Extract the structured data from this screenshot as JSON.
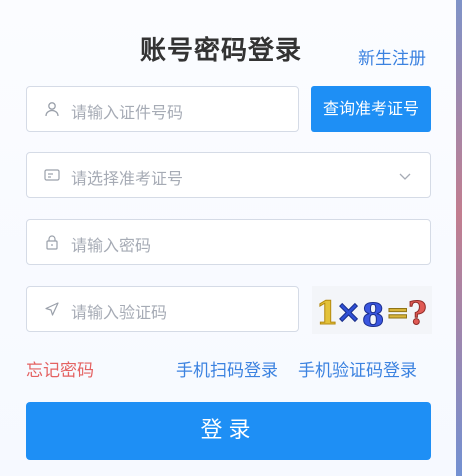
{
  "login": {
    "title": "账号密码登录",
    "register_link": "新生注册",
    "id_field": {
      "placeholder": "请输入证件号码",
      "icon": "user-icon"
    },
    "query_button": "查询准考证号",
    "exam_select": {
      "placeholder": "请选择准考证号",
      "icon": "id-card-icon"
    },
    "password_field": {
      "placeholder": "请输入密码",
      "icon": "lock-icon"
    },
    "captcha_field": {
      "placeholder": "请输入验证码",
      "icon": "navigation-icon"
    },
    "captcha_image": {
      "text": "1×8=?"
    },
    "forgot_password": "忘记密码",
    "scan_login": "手机扫码登录",
    "sms_login": "手机验证码登录",
    "login_button": "登录",
    "colors": {
      "primary": "#1e8ff5",
      "link": "#3b82e0",
      "danger": "#e46262"
    }
  }
}
